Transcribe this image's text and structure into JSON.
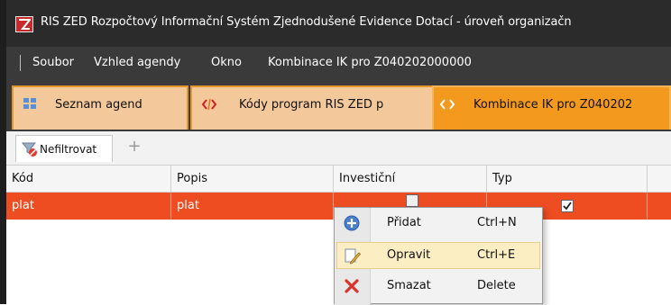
{
  "window": {
    "title": "RIS ZED Rozpočtový Informační Systém Zjednodušené Evidence Dotací - úroveň organizačn"
  },
  "menu": {
    "items": [
      {
        "label": "Soubor"
      },
      {
        "label": "Vzhled agendy"
      },
      {
        "label": "Okno"
      },
      {
        "label": "Kombinace IK pro Z040202000000"
      }
    ]
  },
  "tabs": [
    {
      "label": "Seznam agend",
      "icon": "grid-icon"
    },
    {
      "label": "Kódy program RIS ZED p",
      "icon": "code-icon"
    },
    {
      "label": "Kombinace IK pro Z040202",
      "icon": "code-icon",
      "active": true
    }
  ],
  "toolbar": {
    "filter_label": "Nefiltrovat",
    "add_label": "+"
  },
  "grid": {
    "columns": [
      "Kód",
      "Popis",
      "Investiční",
      "Typ"
    ],
    "rows": [
      {
        "kod": "plat",
        "popis": "plat",
        "investicni": false,
        "typ": true
      }
    ],
    "selected_row_color": "#ee4d22"
  },
  "context_menu": {
    "items": [
      {
        "label": "Přidat",
        "shortcut": "Ctrl+N",
        "icon": "add-icon"
      },
      {
        "label": "Opravit",
        "shortcut": "Ctrl+E",
        "icon": "edit-icon",
        "highlighted": true
      },
      {
        "label": "Smazat",
        "shortcut": "Delete",
        "icon": "delete-icon"
      }
    ]
  },
  "colors": {
    "title_bar": "#2b2b2b",
    "menu_bar": "#3a3a3a",
    "tab_active": "#f39a1e",
    "tab_inactive": "#f3c89b",
    "menu_highlight": "#fbeec2"
  }
}
